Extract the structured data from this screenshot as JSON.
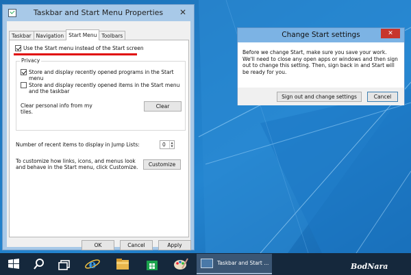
{
  "taskbar_props": {
    "title": "Taskbar and Start Menu Properties",
    "close": "✕",
    "tabs": [
      "Taskbar",
      "Navigation",
      "Start Menu",
      "Toolbars"
    ],
    "use_start_menu": "Use the Start menu instead of the Start screen",
    "privacy": {
      "legend": "Privacy",
      "store_programs": "Store and display recently opened programs in the Start menu",
      "store_items": "Store and display recently opened items in the Start menu and the taskbar",
      "clear_info": "Clear personal info from my tiles.",
      "clear_button": "Clear"
    },
    "jump_lists_label": "Number of recent items to display in Jump Lists:",
    "jump_lists_value": "0",
    "customize_text": "To customize how links, icons, and menus look and behave in the Start menu, click Customize.",
    "customize_button": "Customize",
    "ok": "OK",
    "cancel": "Cancel",
    "apply": "Apply"
  },
  "change_start": {
    "title": "Change Start settings",
    "close": "✕",
    "message": "Before we change Start, make sure you save your work. We'll need to close any open apps or windows and then sign out to change this setting. Then, sign back in and Start will be ready for you.",
    "sign_out_button": "Sign out and change settings",
    "cancel_button": "Cancel"
  },
  "taskbar": {
    "icons": [
      "windows-logo-icon",
      "search-icon",
      "task-view-icon",
      "internet-explorer-icon",
      "file-explorer-icon",
      "store-icon",
      "paint-icon"
    ],
    "active_window": "Taskbar and Start ..."
  },
  "watermark": "BodNara",
  "colors": {
    "desktop": "#1e73b8",
    "taskbar": "#15283c",
    "highlight": "#e00000",
    "dialog_close": "#c7352b"
  }
}
